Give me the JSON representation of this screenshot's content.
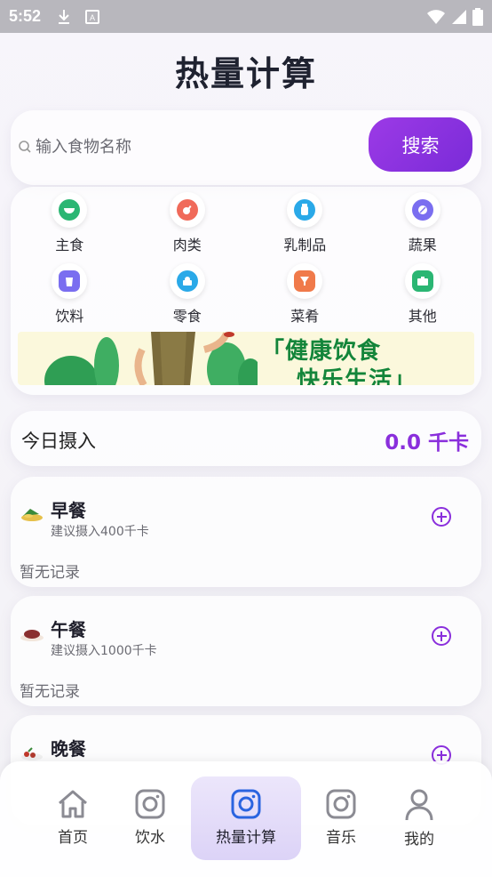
{
  "status_bar": {
    "time": "5:52"
  },
  "page": {
    "title": "热量计算"
  },
  "search": {
    "placeholder": "输入食物名称",
    "button_label": "搜索"
  },
  "categories": [
    {
      "label": "主食",
      "icon": "bowl-icon",
      "color": "#2bb673"
    },
    {
      "label": "肉类",
      "icon": "meat-icon",
      "color": "#f06a5a"
    },
    {
      "label": "乳制品",
      "icon": "milk-icon",
      "color": "#2aa9e8"
    },
    {
      "label": "蔬果",
      "icon": "fruit-icon",
      "color": "#7a6ef0"
    },
    {
      "label": "饮料",
      "icon": "drink-icon",
      "color": "#7a6ef0"
    },
    {
      "label": "零食",
      "icon": "snack-icon",
      "color": "#2aa9e8"
    },
    {
      "label": "菜肴",
      "icon": "dish-icon",
      "color": "#f07a4a"
    },
    {
      "label": "其他",
      "icon": "other-icon",
      "color": "#2bb673"
    }
  ],
  "banner": {
    "line1": "「健康饮食",
    "line2": "快乐生活」"
  },
  "intake": {
    "label": "今日摄入",
    "value": "0.0 千卡"
  },
  "meals": [
    {
      "title": "早餐",
      "subtitle": "建议摄入400千卡",
      "empty": "暂无记录",
      "icon": "breakfast-icon"
    },
    {
      "title": "午餐",
      "subtitle": "建议摄入1000千卡",
      "empty": "暂无记录",
      "icon": "lunch-icon"
    },
    {
      "title": "晚餐",
      "subtitle": "",
      "empty": "",
      "icon": "dinner-icon"
    }
  ],
  "nav": [
    {
      "label": "首页",
      "icon": "home-icon"
    },
    {
      "label": "饮水",
      "icon": "instagram-icon"
    },
    {
      "label": "热量计算",
      "icon": "instagram-icon",
      "active": true
    },
    {
      "label": "音乐",
      "icon": "instagram-icon"
    },
    {
      "label": "我的",
      "icon": "user-icon"
    }
  ],
  "colors": {
    "accent": "#8a2fdc",
    "banner_text": "#13853a"
  }
}
